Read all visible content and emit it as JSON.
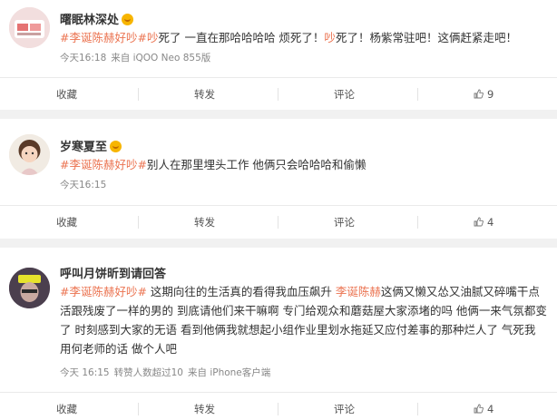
{
  "posts": [
    {
      "user": "曙眠林深处",
      "segments": [
        {
          "text": "#李诞陈赫好吵#",
          "style": "tag"
        },
        {
          "text": "吵",
          "style": "red"
        },
        {
          "text": "死了 一直在那哈哈哈哈 烦死了！",
          "style": "plain"
        },
        {
          "text": "吵",
          "style": "red"
        },
        {
          "text": "死了！杨紫常驻吧！这俩赶紧走吧！",
          "style": "plain"
        }
      ],
      "meta": {
        "time": "今天16:18",
        "source": "来自 iQOO Neo 855版"
      },
      "actions": {
        "collect": "收藏",
        "repost": "转发",
        "comment": "评论",
        "likes": "9"
      }
    },
    {
      "user": "岁寒夏至",
      "segments": [
        {
          "text": "#李诞陈赫好吵#",
          "style": "tag"
        },
        {
          "text": "别人在那里埋头工作 他俩只会哈哈哈和偷懒",
          "style": "plain"
        }
      ],
      "meta": {
        "time": "今天16:15",
        "source": ""
      },
      "actions": {
        "collect": "收藏",
        "repost": "转发",
        "comment": "评论",
        "likes": "4"
      }
    },
    {
      "user": "呼叫月饼昕到请回答",
      "segments": [
        {
          "text": "#李诞陈赫好吵#",
          "style": "tag"
        },
        {
          "text": " 这期向往的生活真的看得我血压飙升 ",
          "style": "plain"
        },
        {
          "text": "李诞陈赫",
          "style": "tag"
        },
        {
          "text": "这俩又懒又怂又油腻又碎嘴干点活跟残废了一样的男的 到底请他们来干嘛啊 专门给观众和蘑菇屋大家添堵的吗 他俩一来气氛都变了 时刻感到大家的无语 看到他俩我就想起小组作业里划水拖延又应付差事的那种烂人了 气死我 用何老师的话 做个人吧",
          "style": "plain"
        }
      ],
      "meta": {
        "time": "今天 16:15",
        "source": "转赞人数超过10",
        "extra": "来自 iPhone客户端"
      },
      "actions": {
        "collect": "收藏",
        "repost": "转发",
        "comment": "评论",
        "likes": "4"
      }
    }
  ],
  "colors": {
    "accent": "#eb7350",
    "badge": "#f7b500"
  }
}
